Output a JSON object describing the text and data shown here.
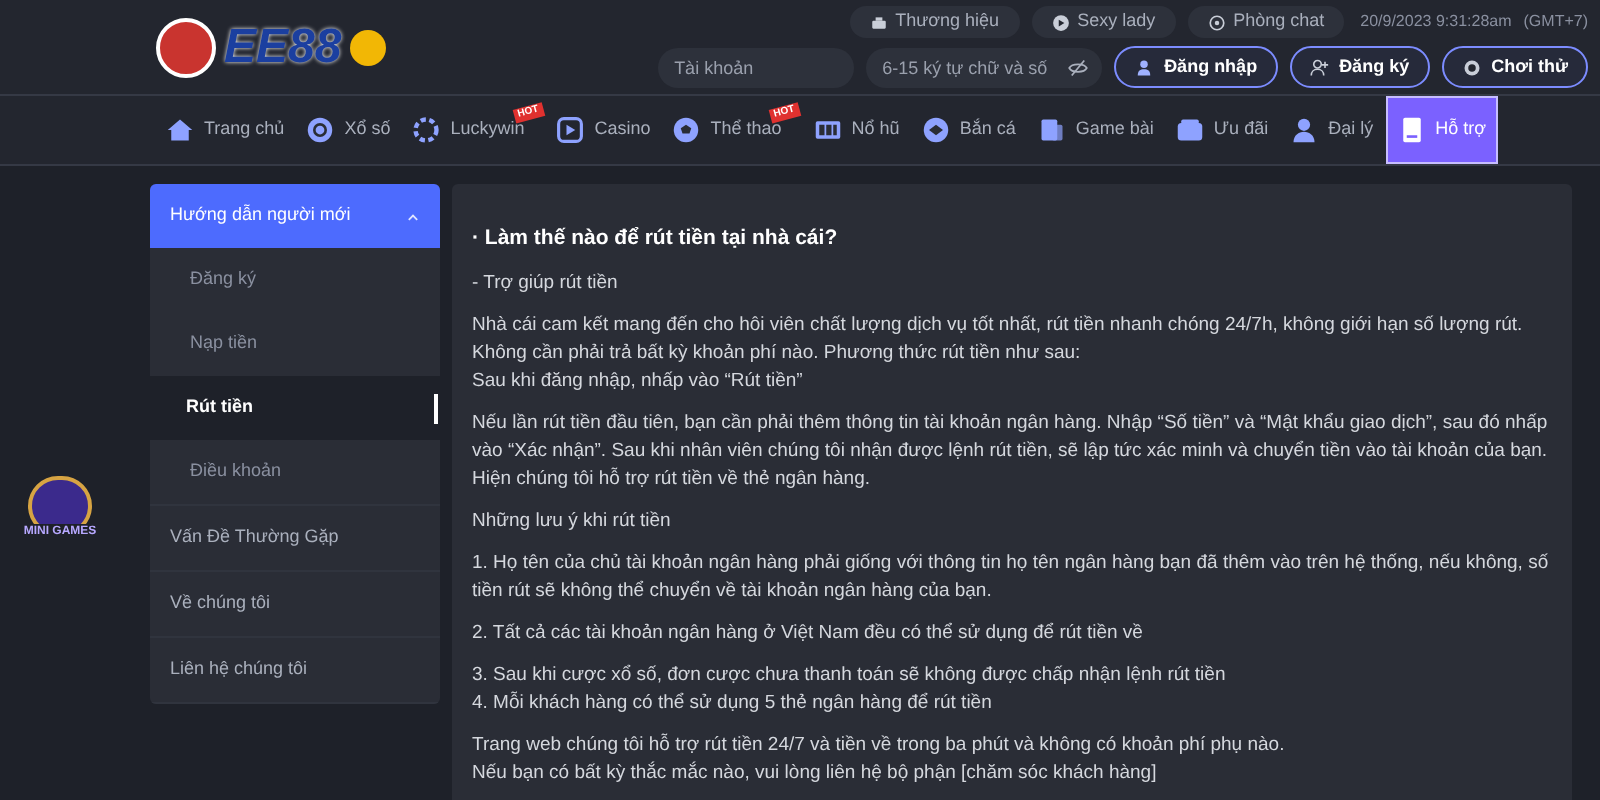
{
  "header": {
    "logo": {
      "text": "EE88"
    },
    "top_links": [
      {
        "label": "Thương hiệu",
        "kind": "brand"
      },
      {
        "label": "Sexy lady",
        "kind": "play"
      },
      {
        "label": "Phòng chat",
        "kind": "chat"
      }
    ],
    "datetime": "20/9/2023 9:31:28am",
    "timezone": "(GMT+7)",
    "username_field": {
      "placeholder": "Tài khoản"
    },
    "password_field": {
      "placeholder": "6-15 ký tự chữ và số"
    },
    "buttons": [
      {
        "label": "Đăng nhập",
        "kind": "login"
      },
      {
        "label": "Đăng ký",
        "kind": "register"
      },
      {
        "label": "Chơi thử",
        "kind": "trial"
      }
    ]
  },
  "nav": [
    {
      "label": "Trang chủ",
      "kind": "home",
      "selected": false
    },
    {
      "label": "Xổ số",
      "kind": "lottery",
      "selected": false
    },
    {
      "label": "Luckywin",
      "kind": "luckywin",
      "selected": false,
      "badge": "HOT"
    },
    {
      "label": "Casino",
      "kind": "casino",
      "selected": false
    },
    {
      "label": "Thể thao",
      "kind": "sports",
      "selected": false,
      "badge": "HOT"
    },
    {
      "label": "Nổ hũ",
      "kind": "slots",
      "selected": false
    },
    {
      "label": "Bắn cá",
      "kind": "fish",
      "selected": false
    },
    {
      "label": "Game bài",
      "kind": "cards",
      "selected": false
    },
    {
      "label": "Ưu đãi",
      "kind": "promo",
      "selected": false
    },
    {
      "label": "Đại lý",
      "kind": "agent",
      "selected": false
    },
    {
      "label": "Hỗ trợ",
      "kind": "support",
      "selected": true
    }
  ],
  "mini_games_badge": {
    "label": "MINI GAMES"
  },
  "sidebar": {
    "items": [
      {
        "label": "Hướng dẫn người mới",
        "expanded": true,
        "children": [
          {
            "label": "Đăng ký",
            "selected": false
          },
          {
            "label": "Nạp tiền",
            "selected": false
          },
          {
            "label": "Rút tiền",
            "selected": true
          },
          {
            "label": "Điều khoản",
            "selected": false
          }
        ]
      },
      {
        "label": "Vấn Đề Thường Gặp",
        "expanded": false
      },
      {
        "label": "Về chúng tôi",
        "expanded": false
      },
      {
        "label": "Liên hệ chúng tôi",
        "expanded": false
      }
    ]
  },
  "article": {
    "title": "· Làm thế nào để rút tiền tại nhà cái?",
    "blocks": [
      {
        "lines": [
          "- Trợ giúp rút tiền"
        ]
      },
      {
        "lines": [
          "Nhà cái cam kết mang đến cho hôi viên chất lượng dịch vụ tốt nhất, rút tiền nhanh chóng 24/7h, không giới hạn số lượng rút. Không cần phải trả bất kỳ khoản phí nào. Phương thức rút tiền như sau:",
          "Sau khi đăng nhập, nhấp vào “Rút tiền”"
        ]
      },
      {
        "lines": [
          "Nếu lần rút tiền đầu tiên, bạn cần phải thêm thông tin tài khoản ngân hàng. Nhập “Số tiền” và “Mật khẩu giao dịch”, sau đó nhấp vào “Xác nhận”. Sau khi nhân viên chúng tôi nhận được lệnh rút tiền, sẽ lập tức xác minh và chuyển tiền vào tài khoản của bạn. Hiện chúng tôi hỗ trợ rút tiền về thẻ ngân hàng."
        ]
      },
      {
        "lines": [
          "Những lưu ý khi rút tiền"
        ]
      },
      {
        "lines": [
          "1. Họ tên của chủ tài khoản ngân hàng phải giống với thông tin họ tên ngân hàng bạn đã thêm vào trên hệ thống, nếu không, số tiền rút sẽ không thể chuyển về tài khoản ngân hàng của bạn."
        ]
      },
      {
        "lines": [
          "2. Tất cả các tài khoản ngân hàng ở Việt Nam đều có thể sử dụng để rút tiền về"
        ]
      },
      {
        "lines": [
          "3. Sau khi cược xổ số, đơn cược chưa thanh toán sẽ không được chấp nhận lệnh rút tiền",
          "4. Mỗi khách hàng có thể sử dụng 5 thẻ ngân hàng để rút tiền"
        ]
      },
      {
        "lines": [
          "Trang web chúng tôi hỗ trợ rút tiền 24/7 và tiền về trong ba phút và không có khoản phí phụ nào.",
          "Nếu bạn có bất kỳ thắc mắc nào, vui lòng liên hệ bộ phận [chăm sóc khách hàng]"
        ]
      }
    ]
  }
}
